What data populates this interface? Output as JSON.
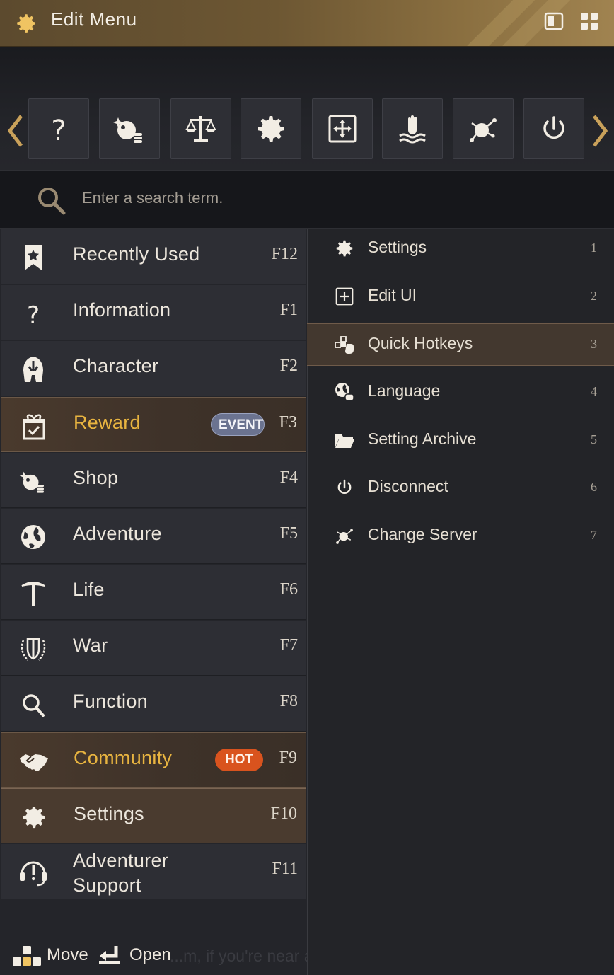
{
  "window": {
    "title": "Edit Menu"
  },
  "titlebar_buttons": [
    {
      "icon": "single-panel-icon"
    },
    {
      "icon": "grid-view-icon"
    }
  ],
  "quick_bar": {
    "items": [
      {
        "icon": "question-icon"
      },
      {
        "icon": "shop-icon"
      },
      {
        "icon": "scales-icon"
      },
      {
        "icon": "gear-icon"
      },
      {
        "icon": "edit-ui-icon"
      },
      {
        "icon": "hand-water-icon"
      },
      {
        "icon": "server-node-icon"
      },
      {
        "icon": "power-icon"
      }
    ]
  },
  "search": {
    "placeholder": "Enter a search term."
  },
  "menu": {
    "items": [
      {
        "label": "Recently Used",
        "key": "F12",
        "icon": "bookmark-star-icon"
      },
      {
        "label": "Information",
        "key": "F1",
        "icon": "question-icon"
      },
      {
        "label": "Character",
        "key": "F2",
        "icon": "helmet-icon"
      },
      {
        "label": "Reward",
        "key": "F3",
        "icon": "gift-icon",
        "badge": "EVENT"
      },
      {
        "label": "Shop",
        "key": "F4",
        "icon": "shop-icon"
      },
      {
        "label": "Adventure",
        "key": "F5",
        "icon": "globe-icon"
      },
      {
        "label": "Life",
        "key": "F6",
        "icon": "pickaxe-icon"
      },
      {
        "label": "War",
        "key": "F7",
        "icon": "shield-laurel-icon"
      },
      {
        "label": "Function",
        "key": "F8",
        "icon": "magnifier-icon"
      },
      {
        "label": "Community",
        "key": "F9",
        "icon": "handshake-icon",
        "badge": "HOT"
      },
      {
        "label": "Settings",
        "key": "F10",
        "icon": "gear-icon"
      },
      {
        "label": "Adventurer\nSupport",
        "key": "F11",
        "icon": "headset-icon"
      }
    ]
  },
  "submenu": {
    "items": [
      {
        "label": "Settings",
        "key": "1",
        "icon": "gear-icon"
      },
      {
        "label": "Edit UI",
        "key": "2",
        "icon": "edit-ui-icon"
      },
      {
        "label": "Quick Hotkeys",
        "key": "3",
        "icon": "hotkeys-icon"
      },
      {
        "label": "Language",
        "key": "4",
        "icon": "globe-chat-icon"
      },
      {
        "label": "Setting Archive",
        "key": "5",
        "icon": "folder-icon"
      },
      {
        "label": "Disconnect",
        "key": "6",
        "icon": "power-icon"
      },
      {
        "label": "Change Server",
        "key": "7",
        "icon": "server-node-icon"
      }
    ]
  },
  "footer": {
    "move_label": "Move",
    "open_label": "Open",
    "hint": "...m, if you're near an"
  },
  "colors": {
    "accent_gold": "#e8b440",
    "event_badge": "#6b7390",
    "hot_badge": "#d9531e",
    "active_row": "#4a3b2f"
  }
}
